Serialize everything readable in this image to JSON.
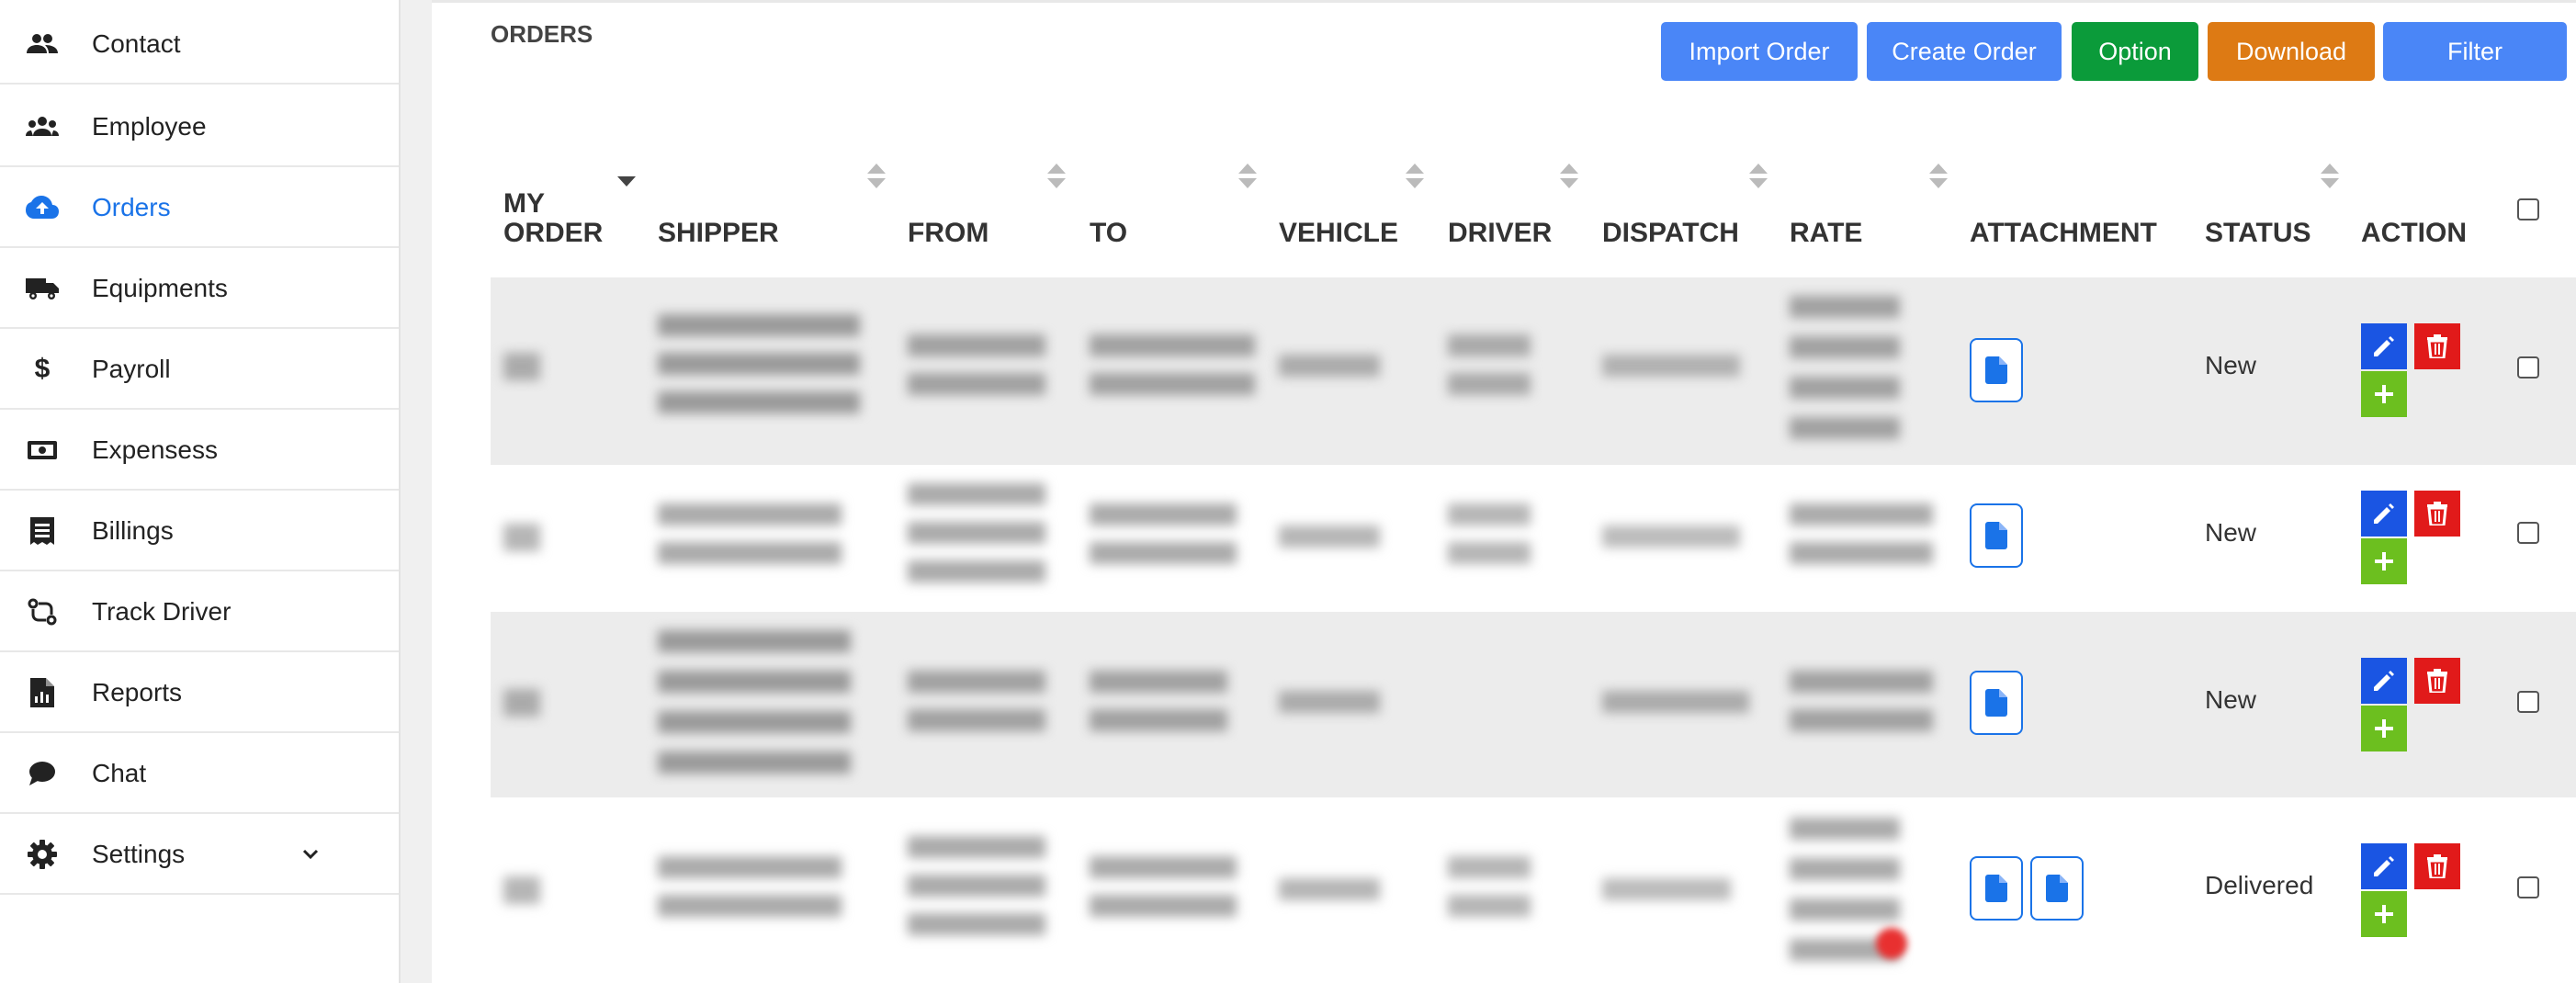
{
  "sidebar": {
    "items": [
      {
        "label": "Contact",
        "icon": "contacts-icon"
      },
      {
        "label": "Employee",
        "icon": "group-icon"
      },
      {
        "label": "Orders",
        "icon": "cloud-upload-icon",
        "active": true
      },
      {
        "label": "Equipments",
        "icon": "truck-icon"
      },
      {
        "label": "Payroll",
        "icon": "dollar-icon"
      },
      {
        "label": "Expensess",
        "icon": "cash-icon"
      },
      {
        "label": "Billings",
        "icon": "receipt-icon"
      },
      {
        "label": "Track Driver",
        "icon": "route-icon"
      },
      {
        "label": "Reports",
        "icon": "report-icon"
      },
      {
        "label": "Chat",
        "icon": "chat-bubble-icon"
      },
      {
        "label": "Settings",
        "icon": "gear-icon",
        "expandable": true
      }
    ]
  },
  "header": {
    "title": "ORDERS",
    "buttons": {
      "import": "Import Order",
      "create": "Create Order",
      "option": "Option",
      "download": "Download",
      "filter": "Filter"
    }
  },
  "colors": {
    "primary_blue": "#4a86f7",
    "option_green": "#0b9b3a",
    "download_orange": "#dd7a14",
    "active_nav": "#1a73e8",
    "edit_blue": "#1a55e3",
    "delete_red": "#e11a1a",
    "add_green": "#6cbf1f"
  },
  "table": {
    "headers": {
      "my_order": "MY ORDER",
      "shipper": "SHIPPER",
      "from": "FROM",
      "to": "TO",
      "vehicle": "VEHICLE",
      "driver": "DRIVER",
      "dispatch": "DISPATCH",
      "rate": "RATE",
      "attachment": "ATTACHMENT",
      "status": "STATUS",
      "action": "ACTION"
    },
    "rows": [
      {
        "status": "New",
        "attachments": 1
      },
      {
        "status": "New",
        "attachments": 1
      },
      {
        "status": "New",
        "attachments": 1
      },
      {
        "status": "Delivered",
        "attachments": 2
      }
    ]
  }
}
